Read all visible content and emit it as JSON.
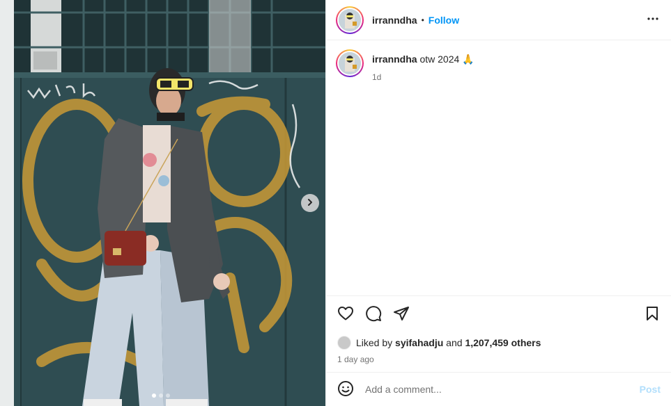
{
  "post": {
    "media": {
      "description_icon": "photo",
      "carousel": {
        "current": 1,
        "total": 3
      },
      "next_icon": "chevron-right-icon"
    },
    "header": {
      "username": "irranndha",
      "separator": "•",
      "follow_label": "Follow",
      "more_icon": "more-horizontal-icon"
    },
    "caption": {
      "username": "irranndha",
      "text": " otw 2024 🙏",
      "time": "1d"
    },
    "actions": {
      "like_icon": "heart-icon",
      "comment_icon": "comment-icon",
      "share_icon": "send-icon",
      "save_icon": "bookmark-icon"
    },
    "likes": {
      "prefix": "Liked by ",
      "liker": "syifahadju",
      "middle": " and ",
      "others": "1,207,459 others"
    },
    "posted_ago": "1 day ago",
    "comment_box": {
      "placeholder": "Add a comment...",
      "post_label": "Post",
      "emoji_icon": "smiley-icon"
    },
    "colors": {
      "follow": "#0095f6",
      "post_disabled": "#b2dffc",
      "muted": "#737373",
      "border": "#efefef"
    }
  }
}
